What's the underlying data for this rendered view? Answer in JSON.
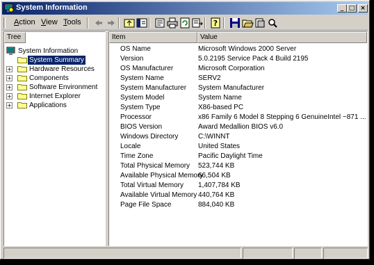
{
  "window": {
    "title": "System Information",
    "buttons": {
      "minimize": "_",
      "maximize": "□",
      "close": "×"
    }
  },
  "menu": {
    "items": [
      {
        "label": "Action",
        "accel": "A",
        "rest": "ction"
      },
      {
        "label": "View",
        "accel": "V",
        "rest": "iew"
      },
      {
        "label": "Tools",
        "accel": "T",
        "rest": "ools"
      }
    ]
  },
  "toolbar": {
    "icons": [
      "back-arrow-icon",
      "forward-arrow-icon",
      "up-folder-icon",
      "show-hide-tree-icon",
      "properties-icon",
      "print-icon",
      "refresh-icon",
      "export-list-icon",
      "help-icon",
      "save-icon",
      "open-icon",
      "report-icon",
      "find-icon"
    ]
  },
  "tree": {
    "header": "Tree",
    "root": "System Information",
    "items": [
      {
        "label": "System Summary",
        "selected": true,
        "expandable": false
      },
      {
        "label": "Hardware Resources",
        "selected": false,
        "expandable": true
      },
      {
        "label": "Components",
        "selected": false,
        "expandable": true
      },
      {
        "label": "Software Environment",
        "selected": false,
        "expandable": true
      },
      {
        "label": "Internet Explorer",
        "selected": false,
        "expandable": true
      },
      {
        "label": "Applications",
        "selected": false,
        "expandable": true
      }
    ]
  },
  "list": {
    "columns": {
      "item": "Item",
      "value": "Value"
    },
    "rows": [
      {
        "item": "OS Name",
        "value": "Microsoft Windows 2000 Server"
      },
      {
        "item": "Version",
        "value": "5.0.2195 Service Pack 4 Build 2195"
      },
      {
        "item": "OS Manufacturer",
        "value": "Microsoft Corporation"
      },
      {
        "item": "System Name",
        "value": "SERV2"
      },
      {
        "item": "System Manufacturer",
        "value": "System Manufacturer"
      },
      {
        "item": "System Model",
        "value": "System Name"
      },
      {
        "item": "System Type",
        "value": "X86-based PC"
      },
      {
        "item": "Processor",
        "value": "x86 Family 6 Model 8 Stepping 6 GenuineIntel ~871 ..."
      },
      {
        "item": "BIOS Version",
        "value": "Award Medallion BIOS v6.0"
      },
      {
        "item": "Windows Directory",
        "value": "C:\\WINNT"
      },
      {
        "item": "Locale",
        "value": "United States"
      },
      {
        "item": "Time Zone",
        "value": "Pacific Daylight Time"
      },
      {
        "item": "Total Physical Memory",
        "value": "523,744 KB"
      },
      {
        "item": "Available Physical Memory",
        "value": "66,504 KB"
      },
      {
        "item": "Total Virtual Memory",
        "value": "1,407,784 KB"
      },
      {
        "item": "Available Virtual Memory",
        "value": "440,764 KB"
      },
      {
        "item": "Page File Space",
        "value": "884,040 KB"
      }
    ]
  },
  "colors": {
    "title_start": "#0a246a",
    "title_end": "#a6caf0",
    "face": "#d4d0c8",
    "selection": "#0a246a"
  }
}
